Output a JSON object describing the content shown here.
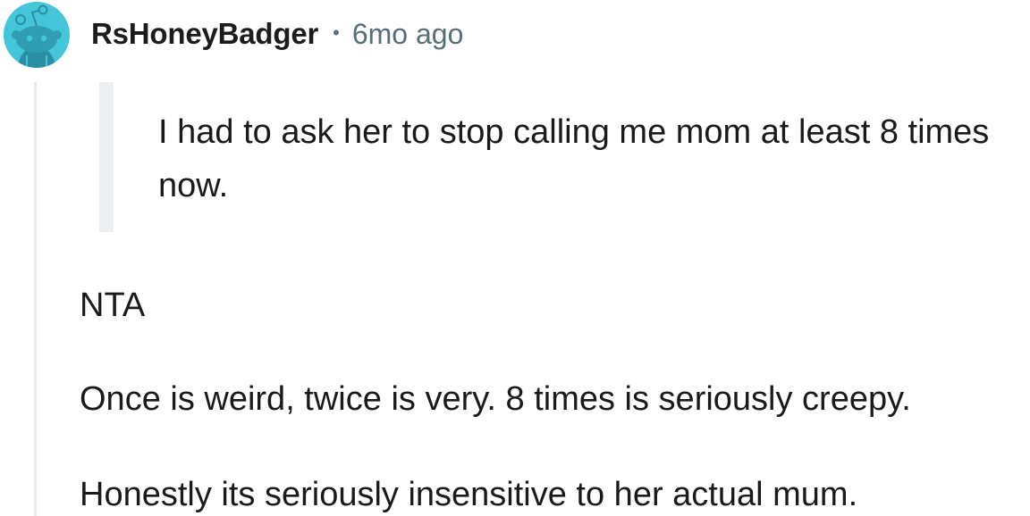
{
  "comment": {
    "author": "RsHoneyBadger",
    "separator": "•",
    "timestamp": "6mo ago",
    "avatar_icon": "reddit-snoo-avatar-icon",
    "quote": "I had to ask her to stop calling me mom at least 8 times now.",
    "paragraphs": [
      "NTA",
      "Once is weird, twice is very. 8 times is seriously creepy.",
      "Honestly its seriously insensitive to her actual mum."
    ]
  },
  "colors": {
    "avatar_bg": "#45c5da",
    "avatar_body": "#2a8fa3",
    "username": "#1c1c1c",
    "meta": "#576f76",
    "thread_line": "#e7e9ea",
    "quote_bar": "#eceeef",
    "text": "#1a1a1b"
  }
}
